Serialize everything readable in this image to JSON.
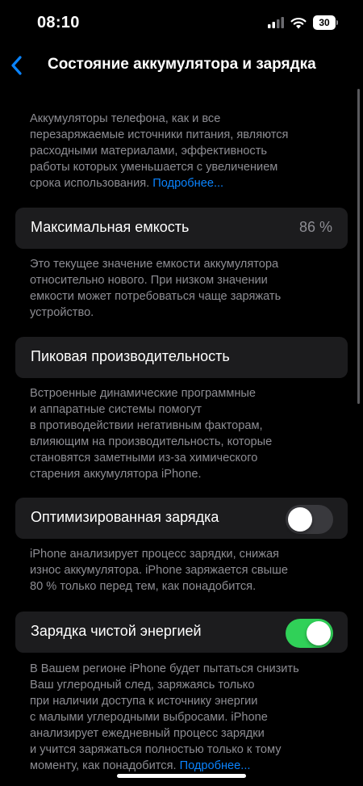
{
  "status_bar": {
    "time": "08:10",
    "battery_level": "30"
  },
  "nav": {
    "title": "Состояние аккумулятора и зарядка",
    "accent_color": "#0a84ff"
  },
  "intro": {
    "lines": [
      "Аккумуляторы телефона, как и все",
      "перезаряжаемые источники питания, являются",
      "расходными материалами, эффективность",
      "работы которых уменьшается с увеличением"
    ],
    "last_line": "срока использования.",
    "link": "Подробнее..."
  },
  "max_capacity": {
    "label": "Максимальная емкость",
    "value": "86 %",
    "description": [
      "Это текущее значение емкости аккумулятора",
      "относительно нового. При низком значении",
      "емкости может потребоваться чаще заряжать",
      "устройство."
    ]
  },
  "peak_performance": {
    "label": "Пиковая производительность",
    "description": [
      "Встроенные динамические программные",
      "и аппаратные системы помогут",
      "в противодействии негативным факторам,",
      "влияющим на производительность, которые",
      "становятся заметными из-за химического",
      "старения аккумулятора iPhone."
    ]
  },
  "optimized_charging": {
    "label": "Оптимизированная зарядка",
    "enabled": false,
    "description": [
      "iPhone анализирует процесс зарядки, снижая",
      "износ аккумулятора. iPhone заряжается свыше",
      "80 % только перед тем, как понадобится."
    ]
  },
  "clean_energy": {
    "label": "Зарядка чистой энергией",
    "enabled": true,
    "toggle_color": "#30d158",
    "description": [
      "В Вашем регионе iPhone будет пытаться снизить",
      "Ваш углеродный след, заряжаясь только",
      "при наличии доступа к источнику энергии",
      "с малыми углеродными выбросами. iPhone",
      "анализирует ежедневный процесс зарядки",
      "и учится заряжаться полностью только к тому"
    ],
    "last_line": "моменту, как понадобится.",
    "link": "Подробнее..."
  }
}
